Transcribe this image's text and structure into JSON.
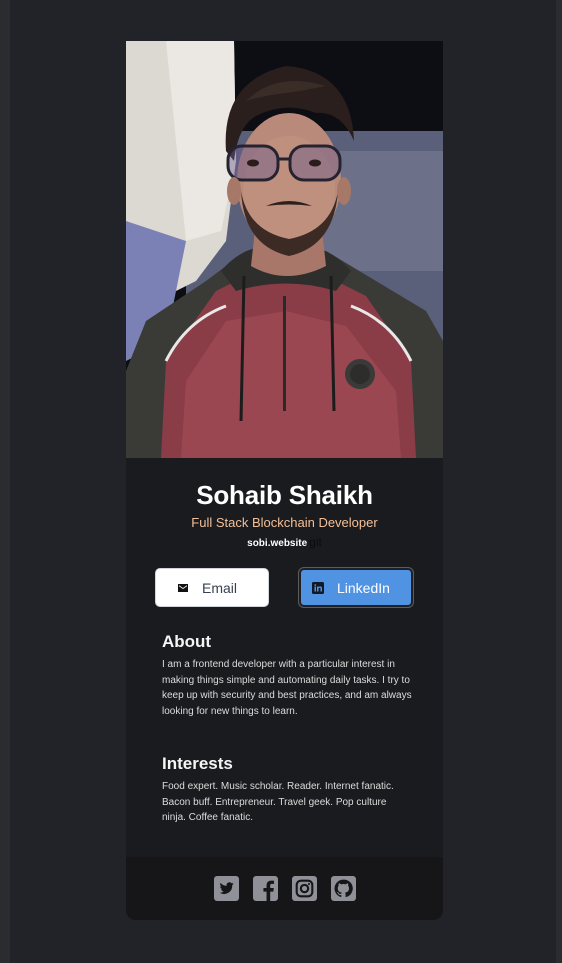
{
  "profile": {
    "name": "Sohaib Shaikh",
    "role": "Full Stack Blockchain Developer",
    "website": "sobi.website",
    "website_suffix": "git"
  },
  "buttons": {
    "email_label": "Email",
    "linkedin_label": "LinkedIn"
  },
  "about": {
    "heading": "About",
    "text": "I am a frontend developer with a particular interest in making things simple and automating daily tasks. I try to keep up with security and best practices, and am always looking for new things to learn."
  },
  "interests": {
    "heading": "Interests",
    "text": "Food expert. Music scholar. Reader. Internet fanatic. Bacon buff. Entrepreneur. Travel geek. Pop culture ninja. Coffee fanatic."
  },
  "footer": {
    "icons": [
      "twitter-icon",
      "facebook-icon",
      "instagram-icon",
      "github-icon"
    ]
  },
  "colors": {
    "role_accent": "#f3bf99",
    "linkedin_blue": "#5093e2",
    "card_bg": "#1a1b1e",
    "footer_bg": "#161618",
    "icon_gray": "#8f9098"
  }
}
